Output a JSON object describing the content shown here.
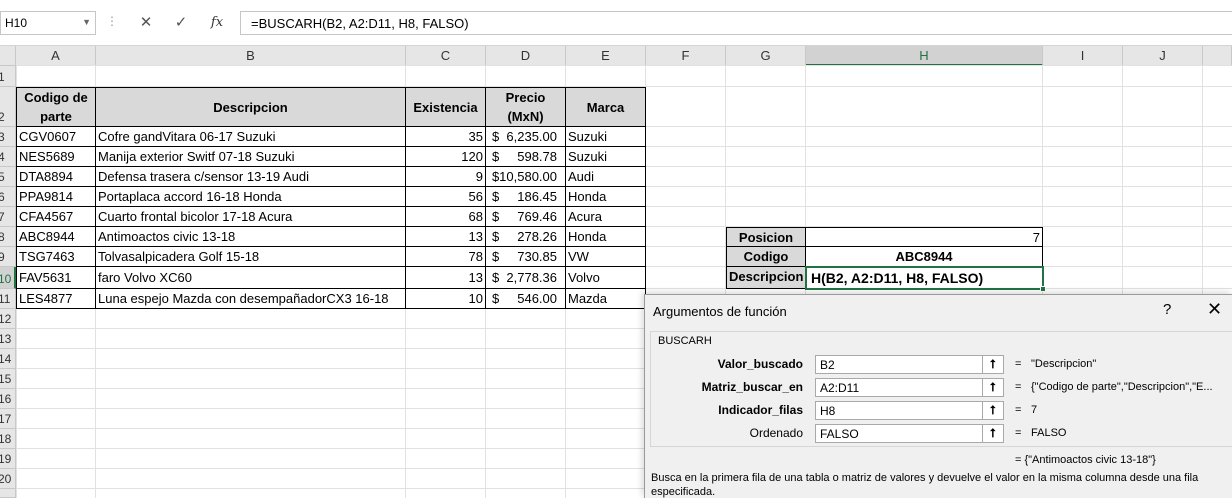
{
  "formula_bar": {
    "name_box": "H10",
    "cancel_glyph": "✕",
    "enter_glyph": "✓",
    "fx_label": "fx",
    "formula": "=BUSCARH(B2, A2:D11, H8, FALSO)"
  },
  "columns": [
    "A",
    "B",
    "C",
    "D",
    "E",
    "F",
    "G",
    "H",
    "I",
    "J"
  ],
  "rows": [
    "1",
    "2",
    "3",
    "4",
    "5",
    "6",
    "7",
    "8",
    "9",
    "10",
    "11",
    "12",
    "13",
    "14",
    "15",
    "16",
    "17",
    "18",
    "19",
    "20"
  ],
  "table": {
    "headers": [
      "Codigo de parte",
      "Descripcion",
      "Existencia",
      "Precio (MxN)",
      "Marca"
    ],
    "rows": [
      {
        "code": "CGV0607",
        "desc": "Cofre gandVitara 06-17 Suzuki",
        "stock": "35",
        "cur": "$",
        "price": "6,235.00",
        "brand": "Suzuki"
      },
      {
        "code": "NES5689",
        "desc": "Manija exterior Switf 07-18 Suzuki",
        "stock": "120",
        "cur": "$",
        "price": "598.78",
        "brand": "Suzuki"
      },
      {
        "code": "DTA8894",
        "desc": "Defensa trasera c/sensor 13-19 Audi",
        "stock": "9",
        "cur": "$",
        "price": "10,580.00",
        "brand": "Audi"
      },
      {
        "code": "PPA9814",
        "desc": "Portaplaca accord 16-18 Honda",
        "stock": "56",
        "cur": "$",
        "price": "186.45",
        "brand": "Honda"
      },
      {
        "code": "CFA4567",
        "desc": "Cuarto frontal bicolor 17-18  Acura",
        "stock": "68",
        "cur": "$",
        "price": "769.46",
        "brand": "Acura"
      },
      {
        "code": "ABC8944",
        "desc": "Antimoactos civic 13-18",
        "stock": "13",
        "cur": "$",
        "price": "278.26",
        "brand": "Honda"
      },
      {
        "code": "TSG7463",
        "desc": "Tolvasalpicadera Golf 15-18",
        "stock": "78",
        "cur": "$",
        "price": "730.85",
        "brand": "VW"
      },
      {
        "code": "FAV5631",
        "desc": "faro Volvo XC60",
        "stock": "13",
        "cur": "$",
        "price": "2,778.36",
        "brand": "Volvo"
      },
      {
        "code": "LES4877",
        "desc": "Luna espejo Mazda con desempañadorCX3 16-18",
        "stock": "10",
        "cur": "$",
        "price": "546.00",
        "brand": "Mazda"
      }
    ]
  },
  "lookup": {
    "posicion_label": "Posicion",
    "posicion_value": "7",
    "codigo_label": "Codigo",
    "codigo_value": "ABC8944",
    "descripcion_label": "Descripcion",
    "descripcion_value": "H(B2, A2:D11, H8, FALSO)"
  },
  "dialog": {
    "title": "Argumentos de función",
    "help": "?",
    "close": "✕",
    "function_name": "BUSCARH",
    "args": [
      {
        "name": "Valor_buscado",
        "value": "B2",
        "result": "\"Descripcion\"",
        "bold": true
      },
      {
        "name": "Matriz_buscar_en",
        "value": "A2:D11",
        "result": "{\"Codigo de parte\",\"Descripcion\",\"E...",
        "bold": true
      },
      {
        "name": "Indicador_filas",
        "value": "H8",
        "result": "7",
        "bold": true
      },
      {
        "name": "Ordenado",
        "value": "FALSO",
        "result": "FALSO",
        "bold": false
      }
    ],
    "picker_glyph": "⭡",
    "equals": "=",
    "result_line": "= {\"Antimoactos civic 13-18\"}",
    "description": "Busca en la primera fila de una tabla o matriz de valores y devuelve el valor en la misma columna desde una fila especificada."
  }
}
